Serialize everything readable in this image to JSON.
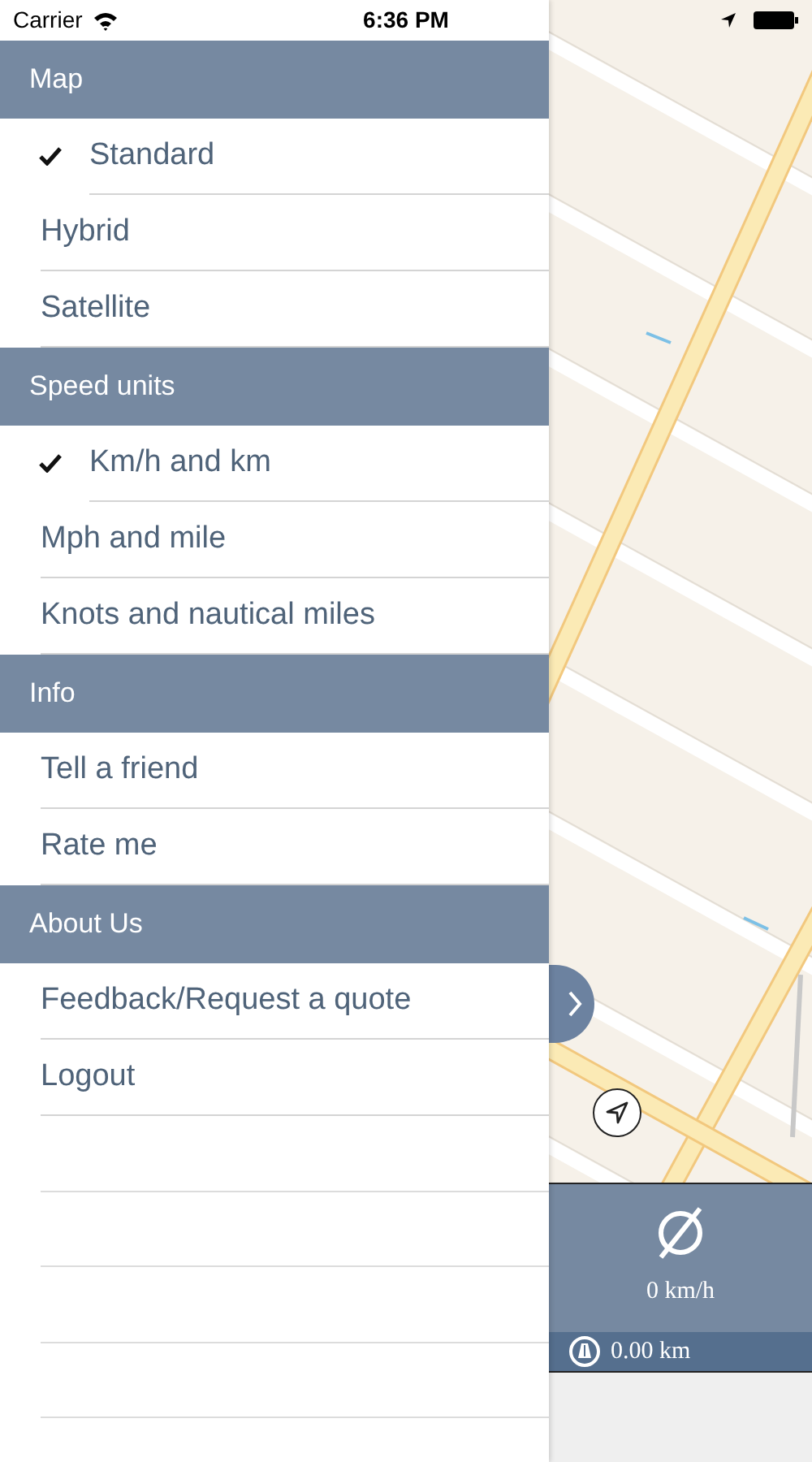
{
  "status_bar": {
    "carrier": "Carrier",
    "time": "6:36 PM"
  },
  "sections": [
    {
      "title": "Map",
      "kind": "choice",
      "items": [
        {
          "label": "Standard",
          "selected": true
        },
        {
          "label": "Hybrid",
          "selected": false
        },
        {
          "label": "Satellite",
          "selected": false
        }
      ]
    },
    {
      "title": "Speed units",
      "kind": "choice",
      "items": [
        {
          "label": "Km/h and km",
          "selected": true
        },
        {
          "label": "Mph and mile",
          "selected": false
        },
        {
          "label": "Knots and nautical miles",
          "selected": false
        }
      ]
    },
    {
      "title": "Info",
      "kind": "links",
      "items": [
        {
          "label": "Tell a friend"
        },
        {
          "label": "Rate me"
        }
      ]
    },
    {
      "title": "About Us",
      "kind": "links",
      "items": [
        {
          "label": "Feedback/Request a quote"
        },
        {
          "label": "Logout"
        }
      ]
    }
  ],
  "speed_panel": {
    "speed": "0 km/h",
    "distance": "0.00 km"
  }
}
